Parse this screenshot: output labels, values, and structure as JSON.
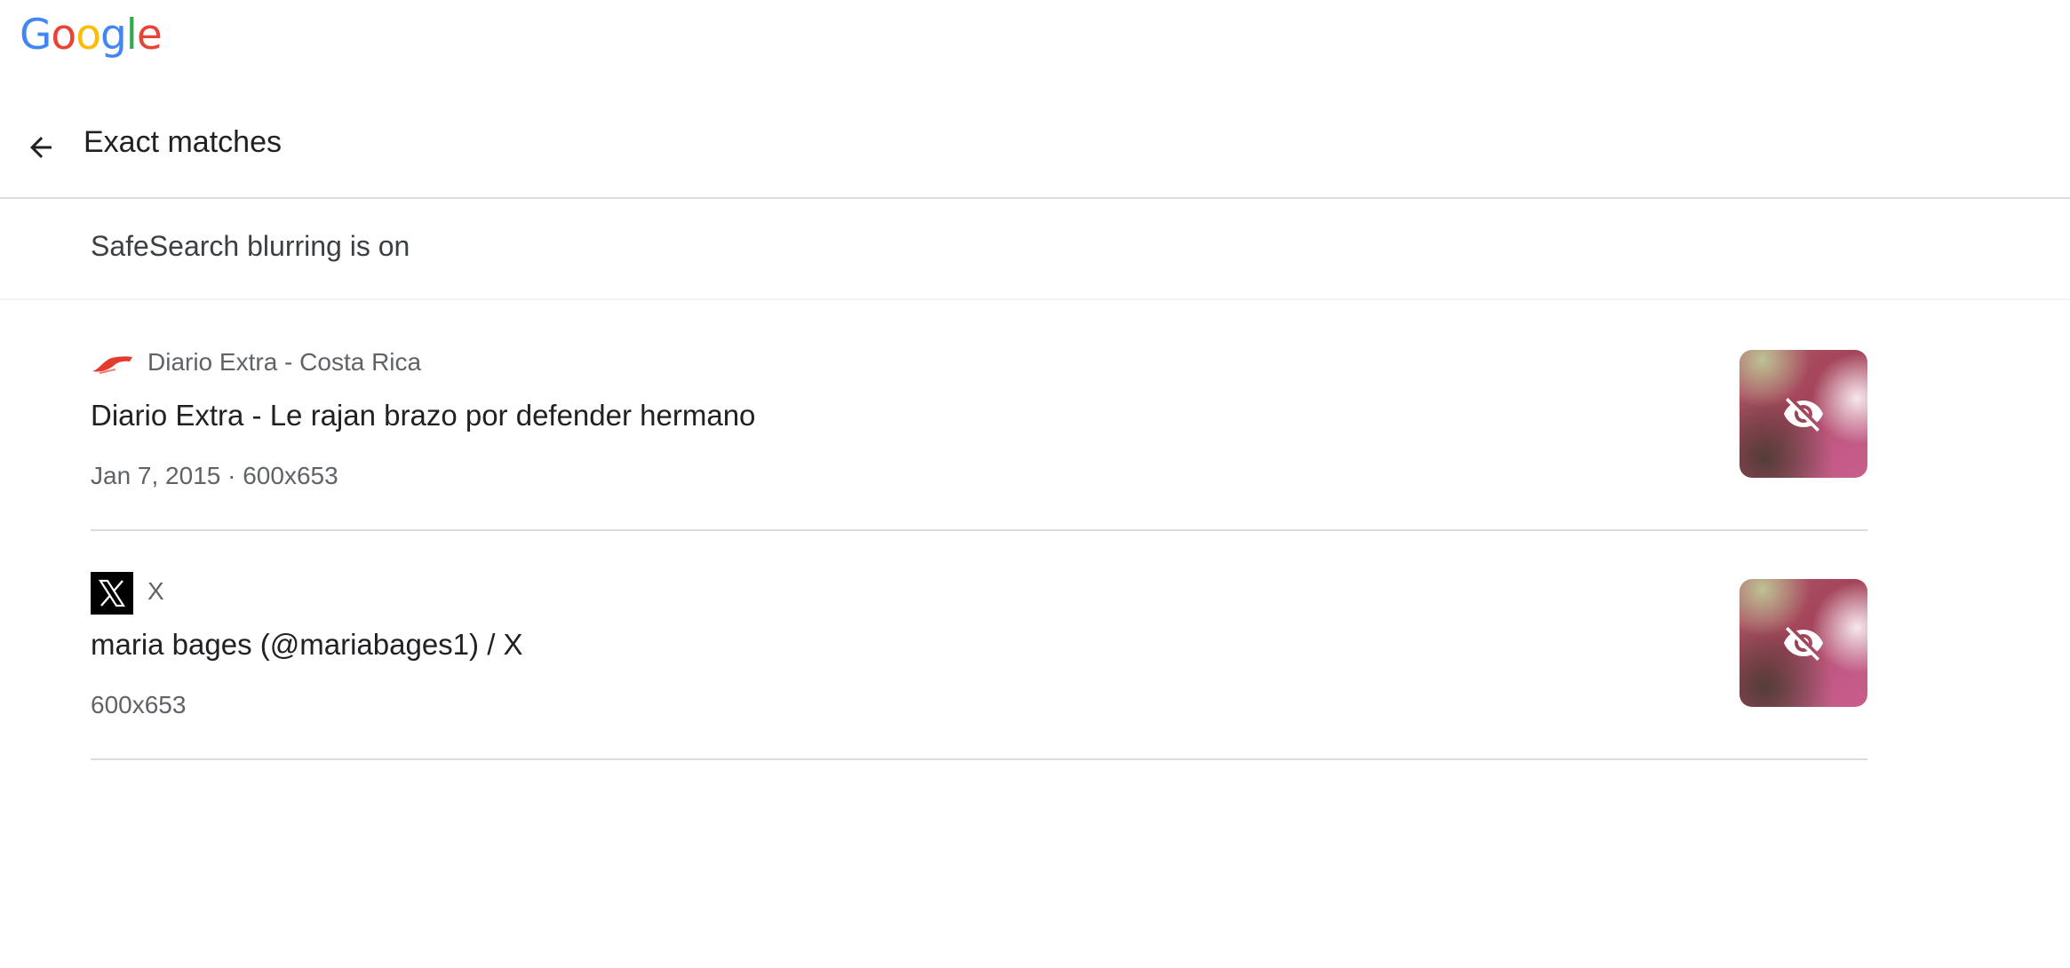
{
  "logo": {
    "letters": [
      "G",
      "o",
      "o",
      "g",
      "l",
      "e"
    ],
    "colors": [
      "#4285F4",
      "#EA4335",
      "#FBBC05",
      "#4285F4",
      "#34A853",
      "#EA4335"
    ]
  },
  "header": {
    "title": "Exact matches",
    "back_icon": "arrow-left-icon"
  },
  "safesearch": {
    "text": "SafeSearch blurring is on"
  },
  "results": [
    {
      "source": "Diario Extra - Costa Rica",
      "favicon": "diario-extra-logo",
      "title": "Diario Extra - Le rajan brazo por defender hermano",
      "meta": "Jan 7, 2015 · 600x653",
      "thumbnail_icon": "eye-off-icon"
    },
    {
      "source": "X",
      "favicon": "x-logo",
      "title": "maria bages (@mariabages1) / X",
      "meta": "600x653",
      "thumbnail_icon": "eye-off-icon"
    }
  ]
}
